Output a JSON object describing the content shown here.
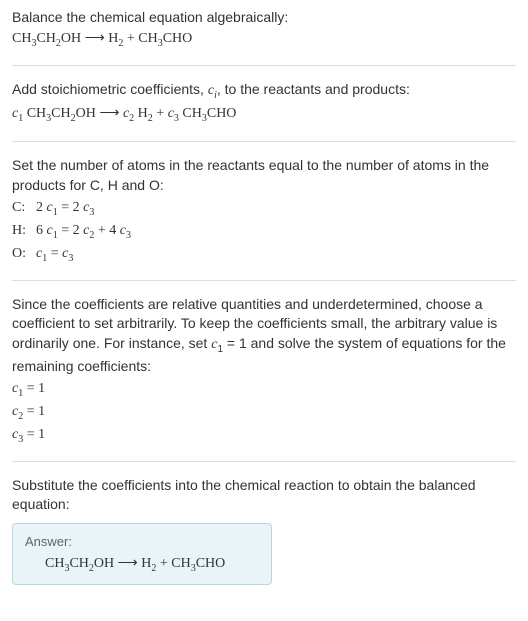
{
  "section1": {
    "instruction": "Balance the chemical equation algebraically:",
    "reactant": "CH",
    "r_sub1": "3",
    "r_mid": "CH",
    "r_sub2": "2",
    "r_end": "OH",
    "arrow": " ⟶ ",
    "p1": "H",
    "p1_sub": "2",
    "plus": " + ",
    "p2": "CH",
    "p2_sub": "3",
    "p2_end": "CHO"
  },
  "section2": {
    "instruction_a": "Add stoichiometric coefficients, ",
    "ci": "c",
    "ci_sub": "i",
    "instruction_b": ", to the reactants and products:",
    "c1": "c",
    "c1_sub": "1",
    "sp": " ",
    "r": "CH",
    "r_sub1": "3",
    "r_mid": "CH",
    "r_sub2": "2",
    "r_end": "OH",
    "arrow": " ⟶ ",
    "c2": "c",
    "c2_sub": "2",
    "p1": " H",
    "p1_sub": "2",
    "plus": " + ",
    "c3": "c",
    "c3_sub": "3",
    "p2": " CH",
    "p2_sub": "3",
    "p2_end": "CHO"
  },
  "section3": {
    "instruction": "Set the number of atoms in the reactants equal to the number of atoms in the products for C, H and O:",
    "rows": [
      {
        "label": "C:",
        "lhs_coeff": "2 ",
        "lhs_c": "c",
        "lhs_sub": "1",
        "eq": " = ",
        "rhs_coeff": "2 ",
        "rhs_c": "c",
        "rhs_sub": "3",
        "extra": ""
      },
      {
        "label": "H:",
        "lhs_coeff": "6 ",
        "lhs_c": "c",
        "lhs_sub": "1",
        "eq": " = ",
        "rhs_coeff": "2 ",
        "rhs_c": "c",
        "rhs_sub": "2",
        "extra_plus": " + ",
        "extra_coeff": "4 ",
        "extra_c": "c",
        "extra_sub": "3"
      },
      {
        "label": "O:",
        "lhs_coeff": "",
        "lhs_c": "c",
        "lhs_sub": "1",
        "eq": " = ",
        "rhs_coeff": "",
        "rhs_c": "c",
        "rhs_sub": "3",
        "extra": ""
      }
    ]
  },
  "section4": {
    "instruction_a": "Since the coefficients are relative quantities and underdetermined, choose a coefficient to set arbitrarily. To keep the coefficients small, the arbitrary value is ordinarily one. For instance, set ",
    "c1": "c",
    "c1_sub": "1",
    "eq1": " = 1",
    "instruction_b": " and solve the system of equations for the remaining coefficients:",
    "results": [
      {
        "c": "c",
        "sub": "1",
        "val": " = 1"
      },
      {
        "c": "c",
        "sub": "2",
        "val": " = 1"
      },
      {
        "c": "c",
        "sub": "3",
        "val": " = 1"
      }
    ]
  },
  "section5": {
    "instruction": "Substitute the coefficients into the chemical reaction to obtain the balanced equation:",
    "answer_label": "Answer:",
    "r": "CH",
    "r_sub1": "3",
    "r_mid": "CH",
    "r_sub2": "2",
    "r_end": "OH",
    "arrow": " ⟶ ",
    "p1": "H",
    "p1_sub": "2",
    "plus": " + ",
    "p2": "CH",
    "p2_sub": "3",
    "p2_end": "CHO"
  }
}
